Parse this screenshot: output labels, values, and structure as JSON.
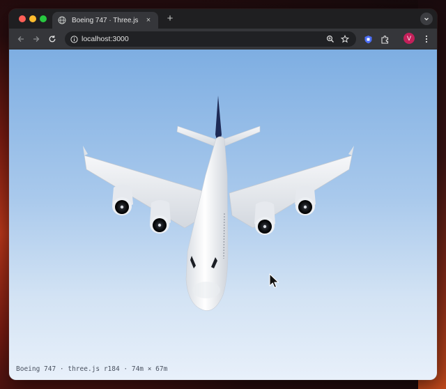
{
  "browser": {
    "tab_title": "Boeing 747 · Three.js",
    "tab_close": "×",
    "new_tab": "+",
    "url": "localhost:3000",
    "avatar_letter": "V"
  },
  "scene": {
    "info": "Boeing 747 · three.js r184 · 74m × 67m"
  },
  "icons": [
    "globe-icon",
    "back-arrow-icon",
    "forward-arrow-icon",
    "reload-icon",
    "info-icon",
    "zoom-icon",
    "star-icon",
    "extension-icon",
    "puzzle-icon",
    "menu-icon",
    "tab-search-icon",
    "mouse-cursor-icon"
  ],
  "colors": {
    "sky_top": "#7eaee2",
    "sky_bottom": "#e8f0fa",
    "tail_accent": "#1e2a55",
    "avatar": "#c4205a"
  }
}
